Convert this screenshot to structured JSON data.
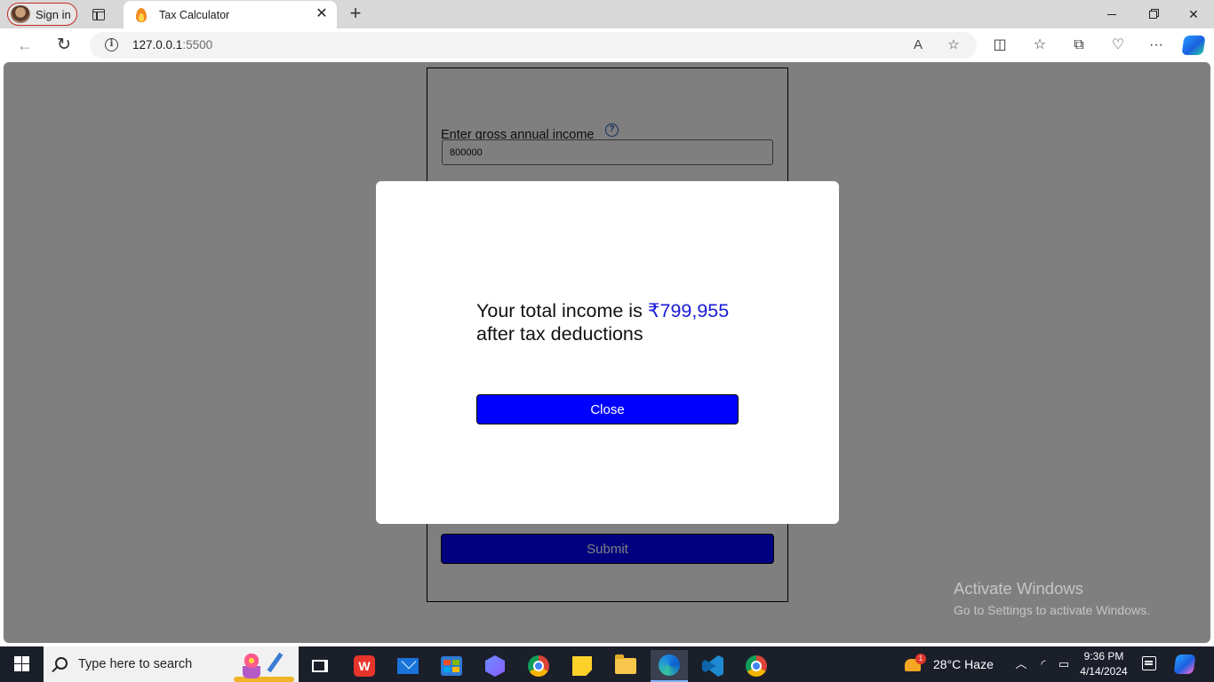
{
  "browser": {
    "signin_label": "Sign in",
    "tab_title": "Tax Calculator",
    "tab_close": "✕",
    "new_tab": "+",
    "url_host": "127.0.0.1",
    "url_port": ":5500",
    "read_aloud": "A",
    "favorite": "☆",
    "split_screen": "◫",
    "favorites": "☆",
    "collections": "⧉",
    "health": "♡",
    "more": "···"
  },
  "form": {
    "income_label": "Enter gross annual income",
    "help_icon": "?",
    "income_value": "800000",
    "submit_label": "Submit"
  },
  "modal": {
    "prefix": "Your total income is ",
    "amount": "₹799,955",
    "suffix": "after tax deductions",
    "close_label": "Close"
  },
  "watermark": {
    "title": "Activate Windows",
    "subtitle": "Go to Settings to activate Windows."
  },
  "taskbar": {
    "search_placeholder": "Type here to search",
    "weather_badge": "1",
    "weather": "28°C  Haze",
    "time": "9:36 PM",
    "date": "4/14/2024"
  },
  "icons": {
    "back": "back-arrow-icon",
    "refresh": "refresh-icon",
    "info": "info-icon",
    "help": "help-icon"
  }
}
